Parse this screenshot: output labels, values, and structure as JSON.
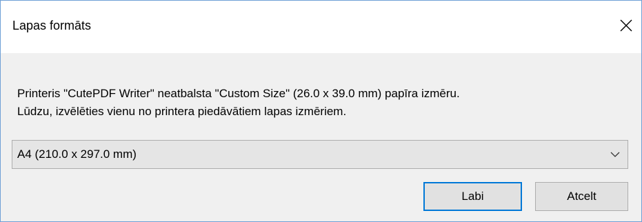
{
  "window": {
    "title": "Lapas formāts",
    "close_icon": "close-icon"
  },
  "message": {
    "line1": "Printeris \"CutePDF Writer\" neatbalsta \"Custom Size\" (26.0 x 39.0 mm) papīra izmēru.",
    "line2": "Lūdzu, izvēlēties vienu no printera piedāvātiem lapas izmēriem."
  },
  "paper_select": {
    "selected": "A4 (210.0 x 297.0 mm)",
    "icon": "chevron-down-icon"
  },
  "buttons": {
    "ok_label": "Labi",
    "cancel_label": "Atcelt"
  },
  "colors": {
    "window_border": "#6e9fd6",
    "focus_border": "#0078d7",
    "dialog_background": "#f0f0f0",
    "titlebar_background": "#ffffff"
  }
}
